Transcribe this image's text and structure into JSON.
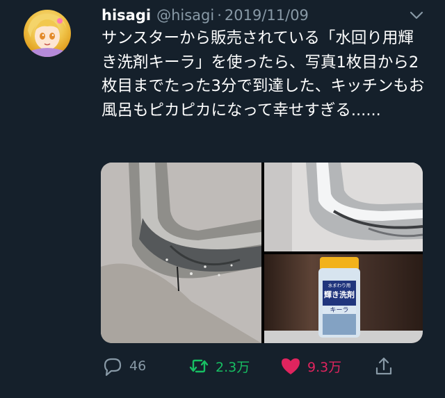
{
  "tweet": {
    "display_name": "hisagi",
    "handle": "@hisagi",
    "separator": "·",
    "date": "2019/11/09",
    "text": "サンスターから販売されている「水回り用輝き洗剤キーラ」を使ったら、写真1枚目から2枚目までたった3分で到達した、キッチンもお風呂もピカピカになって幸せすぎる......"
  },
  "media": {
    "count": 3,
    "product_label_lines": [
      "水まわり用",
      "輝き洗剤",
      "キーラ"
    ]
  },
  "actions": {
    "reply_count": "46",
    "retweet_count": "2.3万",
    "like_count": "9.3万"
  },
  "colors": {
    "background": "#15202b",
    "muted_text": "#8899a6",
    "retweet_green": "#17bf63",
    "like_red": "#e0245e"
  },
  "icons": {
    "menu": "chevron-down-icon",
    "reply": "comment-icon",
    "retweet": "retweet-icon",
    "like": "heart-icon",
    "share": "share-icon"
  }
}
